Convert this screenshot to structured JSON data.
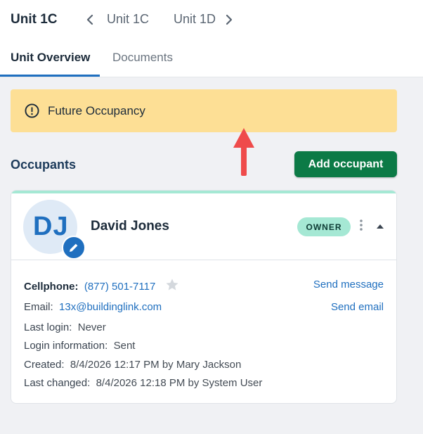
{
  "header": {
    "unit_title": "Unit 1C",
    "nav_units": [
      "Unit 1C",
      "Unit 1D"
    ]
  },
  "tabs": [
    {
      "label": "Unit Overview",
      "active": true
    },
    {
      "label": "Documents",
      "active": false
    }
  ],
  "banner": {
    "text": "Future Occupancy",
    "color": "#fddf95"
  },
  "occupants": {
    "title": "Occupants",
    "add_label": "Add occupant"
  },
  "occupant": {
    "initials": "DJ",
    "name": "David Jones",
    "badge": "OWNER",
    "cellphone_label": "Cellphone:",
    "cellphone": "(877) 501-7117",
    "email_label": "Email:",
    "email": "13x@buildinglink.com",
    "last_login_label": "Last login:",
    "last_login": "Never",
    "login_info_label": "Login information:",
    "login_info": "Sent",
    "created_label": "Created:",
    "created": "8/4/2026 12:17 PM by Mary Jackson",
    "last_changed_label": "Last changed:",
    "last_changed": "8/4/2026 12:18 PM by System User",
    "send_message": "Send message",
    "send_email": "Send email"
  },
  "colors": {
    "accent_blue": "#1f6fbf",
    "add_button": "#0c7a46",
    "owner_badge": "#a5e8d4",
    "annotation_arrow": "#ef4b4b"
  },
  "icons": {
    "prev": "chevron-left-icon",
    "next": "chevron-right-icon",
    "banner": "exclamation-circle-icon",
    "edit": "pencil-icon",
    "kebab": "more-vertical-icon",
    "collapse": "caret-up-icon",
    "favorite": "star-icon"
  }
}
